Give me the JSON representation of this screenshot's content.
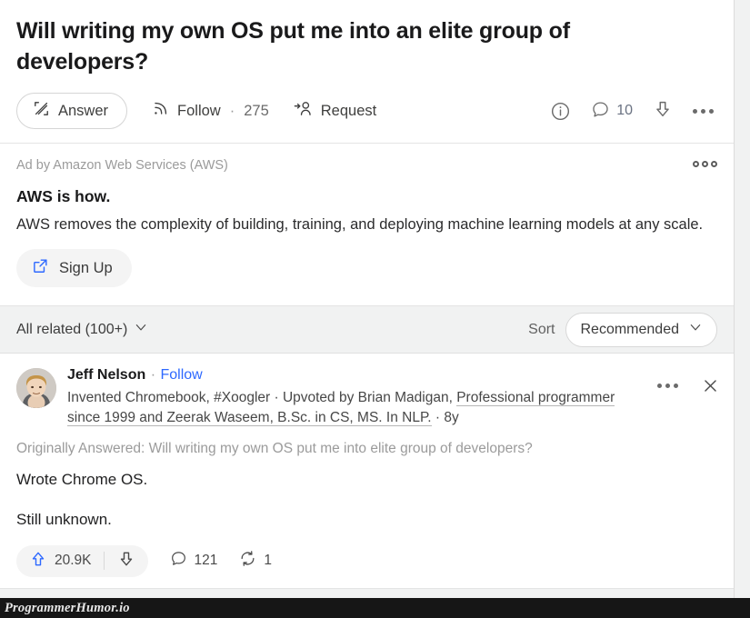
{
  "question": {
    "title": "Will writing my own OS put me into an elite group of developers?",
    "answer_button": "Answer",
    "follow_label": "Follow",
    "follow_separator": "·",
    "follow_count": "275",
    "request_label": "Request",
    "info_icon": "info-circle-icon",
    "comment_icon": "comment-icon",
    "comment_count": "10",
    "downvote_icon": "downvote-arrow-icon",
    "more_icon": "more-horizontal-icon"
  },
  "ad": {
    "label": "Ad by Amazon Web Services (AWS)",
    "headline": "AWS is how.",
    "body": "AWS removes the complexity of building, training, and deploying machine learning models at any scale.",
    "cta_label": "Sign Up",
    "cta_icon": "external-link-icon",
    "menu_icon": "more-options-icon"
  },
  "sortbar": {
    "filter_label": "All related (100+)",
    "filter_chevron": "chevron-down-icon",
    "sort_label": "Sort",
    "sort_value": "Recommended",
    "sort_chevron": "chevron-down-icon"
  },
  "answer": {
    "author_name": "Jeff Nelson",
    "author_separator": "·",
    "follow_link": "Follow",
    "credential_prefix": "Invented Chromebook, #Xoogler · Upvoted by Brian Madigan, ",
    "credential_underlined": "Professional programmer since 1999 and Zeerak Waseem, B.Sc. in CS, MS. In NLP.",
    "credential_suffix": " · 8y",
    "time_ago": "8y",
    "originally_answered": "Originally Answered: Will writing my own OS put me into elite group of developers?",
    "paragraphs": [
      "Wrote Chrome OS.",
      "Still unknown."
    ],
    "more_icon": "more-horizontal-icon",
    "close_icon": "close-x-icon",
    "upvote_icon": "upvote-arrow-icon",
    "upvote_count": "20.9K",
    "downvote_icon": "downvote-arrow-icon",
    "comment_icon": "comment-icon",
    "comment_count": "121",
    "share_icon": "repost-icon",
    "share_count": "1"
  },
  "watermark": {
    "text": "ProgrammerHumor.io"
  },
  "colors": {
    "accent_blue": "#2e69ff",
    "link_blue": "#2e69ff",
    "page_bg": "#f1f2f2",
    "card_bg": "#ffffff",
    "watermark_bg": "#161616"
  }
}
